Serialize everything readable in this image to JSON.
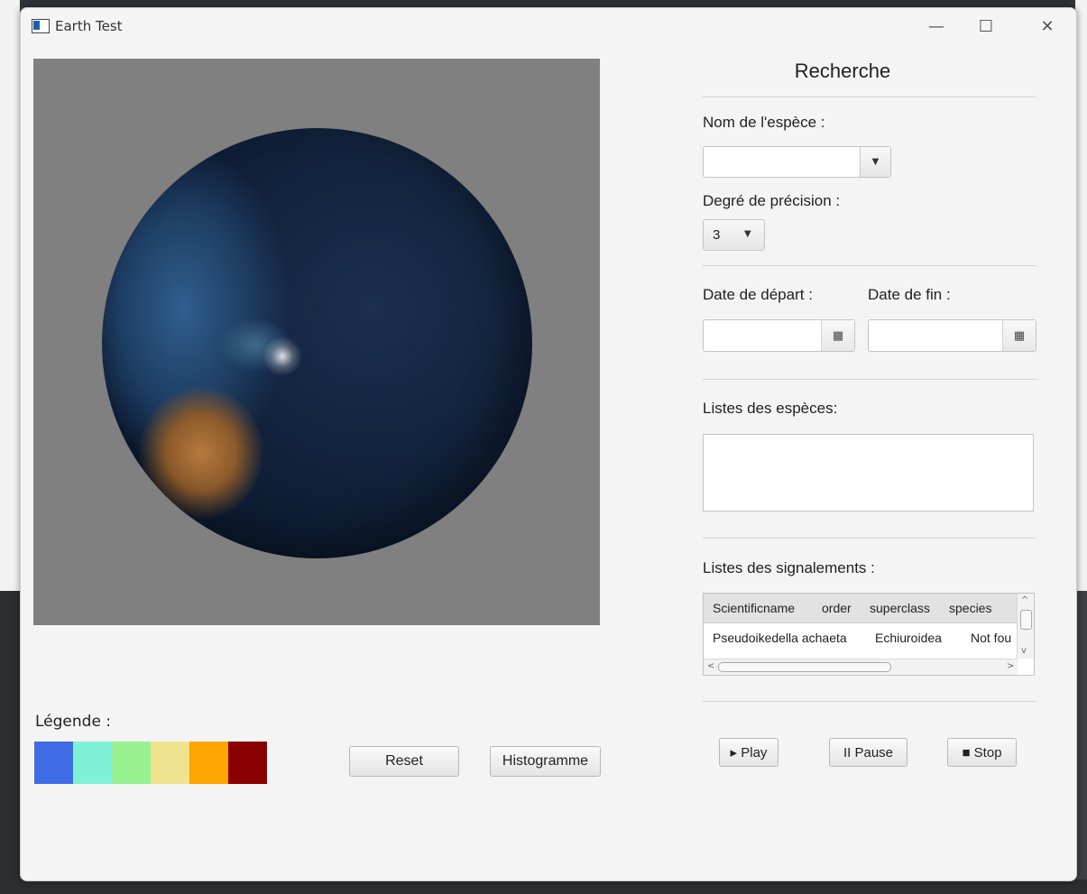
{
  "window": {
    "title": "Earth Test",
    "controls": {
      "minimize": "—",
      "maximize": "☐",
      "close": "✕"
    }
  },
  "legend": {
    "label": "Légende :",
    "colors": [
      "#3f6be3",
      "#7ff2d6",
      "#98f090",
      "#efe38f",
      "#ffa500",
      "#8b0000"
    ]
  },
  "buttons": {
    "reset": "Reset",
    "histogram": "Histogramme"
  },
  "search": {
    "title": "Recherche",
    "species_name_label": "Nom de l'espèce :",
    "species_name_value": "",
    "precision_label": "Degré de précision :",
    "precision_value": "3",
    "start_date_label": "Date de départ :",
    "end_date_label": "Date de fin :",
    "species_list_label": "Listes des espèces:",
    "reports_label": "Listes des signalements :"
  },
  "reports_table": {
    "columns": [
      "Scientificname",
      "order",
      "superclass",
      "species"
    ],
    "rows": [
      [
        "Pseudoikedella achaeta",
        "Echiuroidea",
        "Not fou"
      ]
    ]
  },
  "playback": {
    "play": "▸ Play",
    "pause": "II Pause",
    "stop": "■ Stop"
  }
}
